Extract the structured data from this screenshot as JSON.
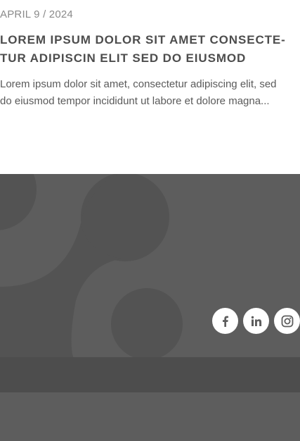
{
  "article": {
    "date": "APRIL 9 / 2024",
    "title_line1": "LOREM IPSUM DOLOR SIT AMET CONSECTE-",
    "title_line2": "TUR ADIPISCIN ELIT SED DO EIUSMOD",
    "excerpt_line1": "Lorem ipsum dolor sit amet, consectetur adipiscing elit, sed",
    "excerpt_line2": "do eiusmod tempor incididunt ut labore et dolore magna..."
  },
  "footer": {
    "social": [
      {
        "name": "facebook",
        "icon": "facebook-icon"
      },
      {
        "name": "linkedin",
        "icon": "linkedin-icon"
      },
      {
        "name": "instagram",
        "icon": "instagram-icon"
      }
    ]
  },
  "colors": {
    "footer_bg": "#5d5d5d",
    "footer_shape": "#535353",
    "footer_band": "#4d4d4d",
    "icon_bg": "#ffffff",
    "icon_fg": "#5d5d5d"
  }
}
